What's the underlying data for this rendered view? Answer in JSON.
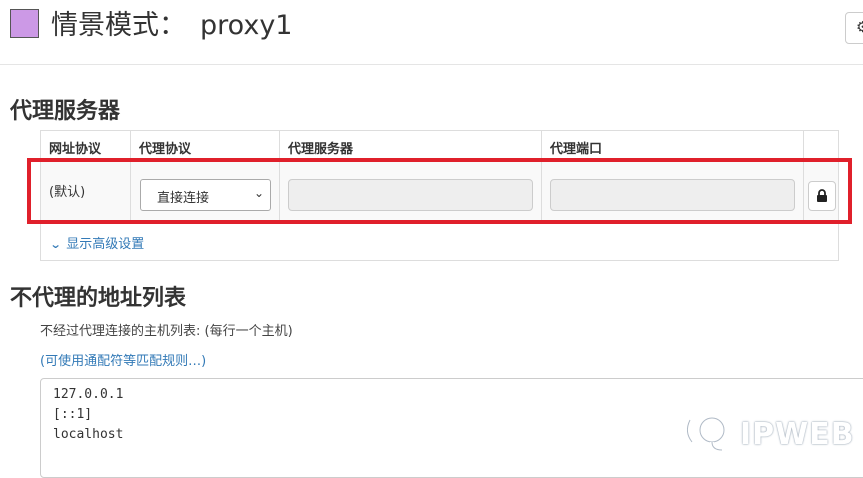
{
  "header": {
    "title_prefix": "情景模式：",
    "profile_name": "proxy1",
    "swatch_color": "#cc99e6"
  },
  "proxy_section": {
    "heading": "代理服务器",
    "columns": [
      "网址协议",
      "代理协议",
      "代理服务器",
      "代理端口"
    ],
    "row": {
      "scheme": "(默认)",
      "protocol_selected": "直接连接",
      "server": "",
      "port": ""
    },
    "advanced_link": "显示高级设置",
    "lock_icon": "lock-icon",
    "highlight_color": "#e0202b"
  },
  "bypass_section": {
    "heading": "不代理的地址列表",
    "description": "不经过代理连接的主机列表: (每行一个主机)",
    "wildcard_link": "(可使用通配符等匹配规则…)",
    "entries": [
      "127.0.0.1",
      "[::1]",
      "localhost"
    ]
  },
  "watermark": {
    "text": "IPWEB"
  }
}
